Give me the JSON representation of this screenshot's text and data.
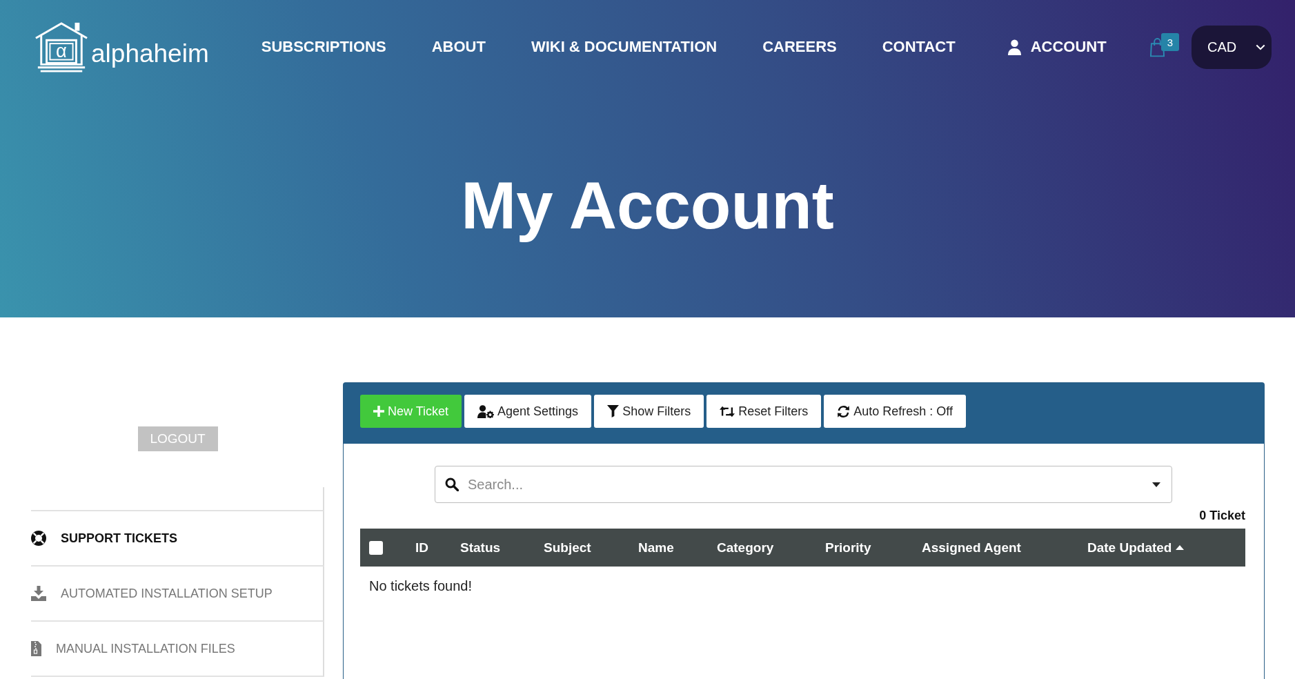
{
  "header": {
    "logo": {
      "symbol": "α",
      "name": "alphaheim"
    },
    "nav": [
      {
        "label": "SUBSCRIPTIONS",
        "kind": "link"
      },
      {
        "label": "ABOUT",
        "kind": "link"
      },
      {
        "label": "WIKI & DOCUMENTATION",
        "kind": "link"
      },
      {
        "label": "CAREERS",
        "kind": "link"
      },
      {
        "label": "CONTACT",
        "kind": "link"
      },
      {
        "label": "ACCOUNT",
        "kind": "account"
      }
    ],
    "cart": {
      "badge": "3"
    },
    "currency": {
      "value": "CAD"
    }
  },
  "hero": {
    "title": "My Account"
  },
  "sidebar": {
    "logout": "LOGOUT",
    "items": [
      {
        "label": "SUPPORT TICKETS",
        "selected": true
      },
      {
        "label": "AUTOMATED INSTALLATION SETUP",
        "selected": false
      },
      {
        "label": "MANUAL INSTALLATION FILES",
        "selected": false
      }
    ]
  },
  "tickets": {
    "toolbar": [
      {
        "label": "New Ticket",
        "kind": "primary"
      },
      {
        "label": "Agent Settings",
        "kind": "default"
      },
      {
        "label": "Show Filters",
        "kind": "default"
      },
      {
        "label": "Reset Filters",
        "kind": "default"
      },
      {
        "label": "Auto Refresh : Off",
        "kind": "default"
      }
    ],
    "search": {
      "placeholder": "Search..."
    },
    "count": "0 Ticket",
    "table": {
      "select_all": {
        "checked": false
      },
      "columns": [
        {
          "label": "ID",
          "sorted": false
        },
        {
          "label": "Status",
          "sorted": false
        },
        {
          "label": "Subject",
          "sorted": false
        },
        {
          "label": "Name",
          "sorted": false
        },
        {
          "label": "Category",
          "sorted": false
        },
        {
          "label": "Priority",
          "sorted": false
        },
        {
          "label": "Assigned Agent",
          "sorted": false
        },
        {
          "label": "Date Updated",
          "sorted": true
        }
      ],
      "empty_message": "No tickets found!"
    }
  }
}
